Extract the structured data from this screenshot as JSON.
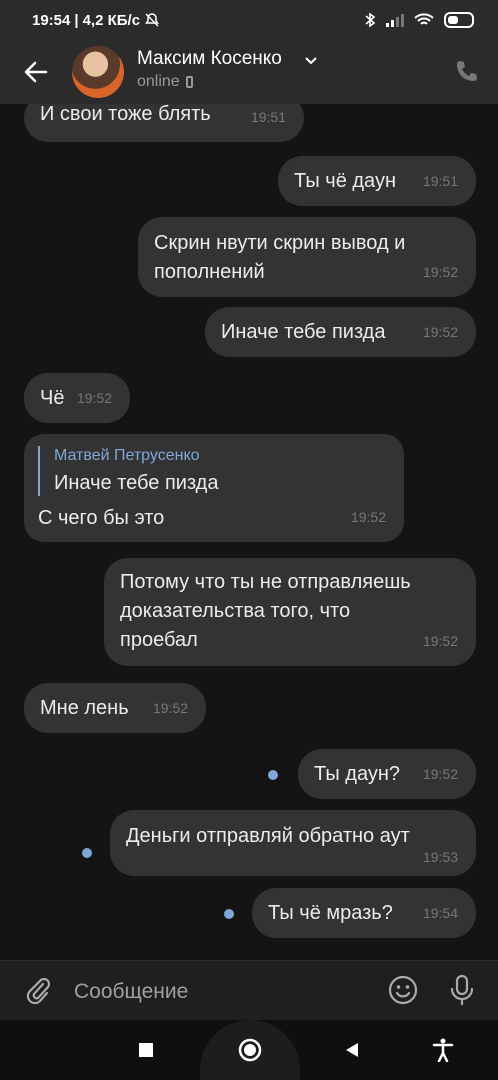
{
  "status_bar": {
    "time": "19:54",
    "speed": "4,2 КБ/с"
  },
  "header": {
    "name": "Максим Косенко",
    "status": "online"
  },
  "messages": [
    {
      "text": "И свои тоже блять",
      "time": "19:51"
    },
    {
      "text": "Ты чё даун",
      "time": "19:51"
    },
    {
      "text": "Скрин нвути  скрин вывод и",
      "text2": "пополнений",
      "time": "19:52"
    },
    {
      "text": "Иначе тебе пизда",
      "time": "19:52"
    },
    {
      "text": "Чё",
      "time": "19:52"
    },
    {
      "reply_name": "Матвей Петрусенко",
      "reply_text": "Иначе тебе пизда",
      "text": "С чего бы это",
      "time": "19:52"
    },
    {
      "text": "Потому что ты не отправляешь",
      "text2": "доказательства того, что",
      "text3": "проебал",
      "time": "19:52"
    },
    {
      "text": "Мне лень",
      "time": "19:52"
    },
    {
      "text": "Ты даун?",
      "time": "19:52"
    },
    {
      "text": "Деньги отправляй обратно аут",
      "time": "19:53"
    },
    {
      "text": "Ты чё мразь?",
      "time": "19:54"
    }
  ],
  "composer": {
    "placeholder": "Сообщение"
  },
  "colors": {
    "bubble": "#333333",
    "background": "#141414",
    "accent": "#7fa7d9"
  },
  "icons": [
    "back-arrow-icon",
    "chevron-down-icon",
    "phone-icon",
    "attach-icon",
    "emoji-icon",
    "mic-icon",
    "bell-off-icon",
    "bluetooth-icon",
    "signal-icon",
    "wifi-icon",
    "battery-icon"
  ]
}
